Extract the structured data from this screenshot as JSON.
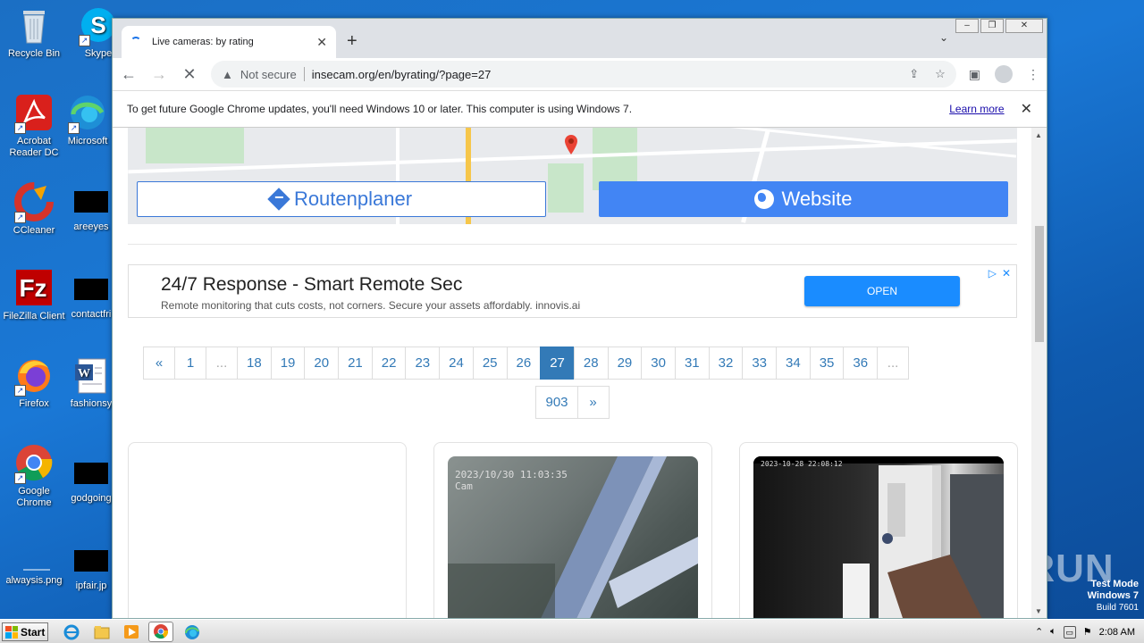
{
  "desktop": {
    "icons": [
      {
        "label": "Recycle Bin",
        "icon": "recycle-bin-icon"
      },
      {
        "label": "Skype",
        "icon": "skype-icon"
      },
      {
        "label": "Acrobat Reader DC",
        "icon": "acrobat-icon"
      },
      {
        "label": "Microsoft",
        "icon": "edge-icon"
      },
      {
        "label": "CCleaner",
        "icon": "ccleaner-icon"
      },
      {
        "label": "areeyes",
        "icon": "file-icon"
      },
      {
        "label": "FileZilla Client",
        "icon": "filezilla-icon"
      },
      {
        "label": "contactfri",
        "icon": "file-icon"
      },
      {
        "label": "Firefox",
        "icon": "firefox-icon"
      },
      {
        "label": "fashionsy",
        "icon": "word-icon"
      },
      {
        "label": "Google Chrome",
        "icon": "chrome-icon"
      },
      {
        "label": "godgoing",
        "icon": "file-icon"
      },
      {
        "label": "alwaysis.png",
        "icon": "image-icon"
      },
      {
        "label": "ipfair.jp",
        "icon": "file-icon"
      }
    ]
  },
  "browser": {
    "tab_title": "Live cameras: by rating",
    "new_tab_symbol": "+",
    "window_controls": {
      "minimize": "–",
      "maximize": "❐",
      "close": "✕"
    },
    "url": "insecam.org/en/byrating/?page=27",
    "security_label": "Not secure",
    "infobar_text": "To get future Google Chrome updates, you'll need Windows 10 or later. This computer is using Windows 7.",
    "infobar_link": "Learn more"
  },
  "page": {
    "route_button": "Routenplaner",
    "website_button": "Website",
    "ad": {
      "title": "24/7 Response - Smart Remote Sec",
      "description": "Remote monitoring that cuts costs, not corners. Secure your assets affordably. innovis.ai",
      "cta": "OPEN"
    },
    "pagination": {
      "row1": [
        "«",
        "1",
        "...",
        "18",
        "19",
        "20",
        "21",
        "22",
        "23",
        "24",
        "25",
        "26",
        "27",
        "28",
        "29",
        "30",
        "31",
        "32",
        "33",
        "34",
        "35",
        "36",
        "..."
      ],
      "row2": [
        "903",
        "»"
      ],
      "active": "27"
    },
    "cameras": [
      {
        "timestamp": "2023/10/30 11:03:35\nCam"
      },
      {
        "timestamp": "2023-10-28 22:08:12"
      }
    ]
  },
  "taskbar": {
    "start_label": "Start",
    "clock": "2:08 AM"
  },
  "watermark": {
    "line1": "Test Mode",
    "line2": "Windows 7",
    "line3": "Build 7601",
    "brand": "ANY RUN"
  }
}
